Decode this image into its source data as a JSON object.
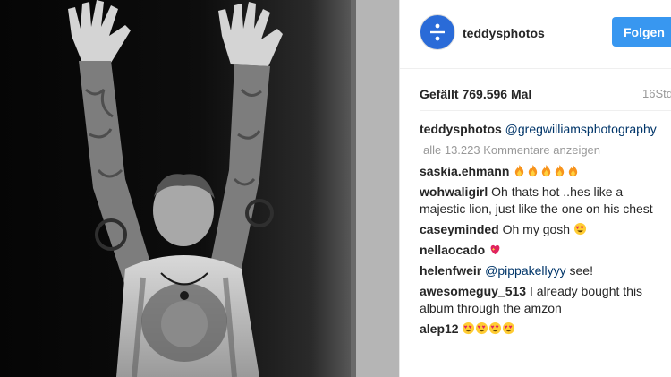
{
  "post": {
    "username": "teddysphotos",
    "follow_label": "Folgen",
    "likes": "Gefällt 769.596 Mal",
    "time_ago": "16Std",
    "caption_user": "teddysphotos",
    "caption_mention": "@gregwilliamsphotography",
    "view_all_comments": "alle 13.223 Kommentare anzeigen"
  },
  "comments": [
    {
      "user": "saskia.ehmann",
      "text": "",
      "emoji": [
        "fire-emoji",
        "fire-emoji",
        "fire-emoji",
        "fire-emoji",
        "fire-emoji"
      ]
    },
    {
      "user": "wohwaligirl",
      "text": "Oh thats hot ..hes like a majestic lion, just like the one on his chest",
      "emoji": []
    },
    {
      "user": "caseyminded",
      "text": "Oh my gosh",
      "emoji": [
        "heart-eyes-emoji"
      ]
    },
    {
      "user": "nellaocado",
      "text": "",
      "emoji": [
        "sparkling-heart-emoji"
      ]
    },
    {
      "user": "helenfweir",
      "mention": "@pippakellyyy",
      "text": "see!",
      "emoji": []
    },
    {
      "user": "awesomeguy_513",
      "text": "I already bought this album through the amzon",
      "emoji": []
    },
    {
      "user": "alep12",
      "text": "",
      "emoji": [
        "heart-eyes-emoji",
        "heart-eyes-emoji",
        "heart-eyes-emoji",
        "heart-eyes-emoji"
      ]
    }
  ],
  "colors": {
    "follow_button": "#3897f0",
    "mention": "#003569",
    "muted": "#999999",
    "avatar_bg": "#2a6bd8"
  }
}
